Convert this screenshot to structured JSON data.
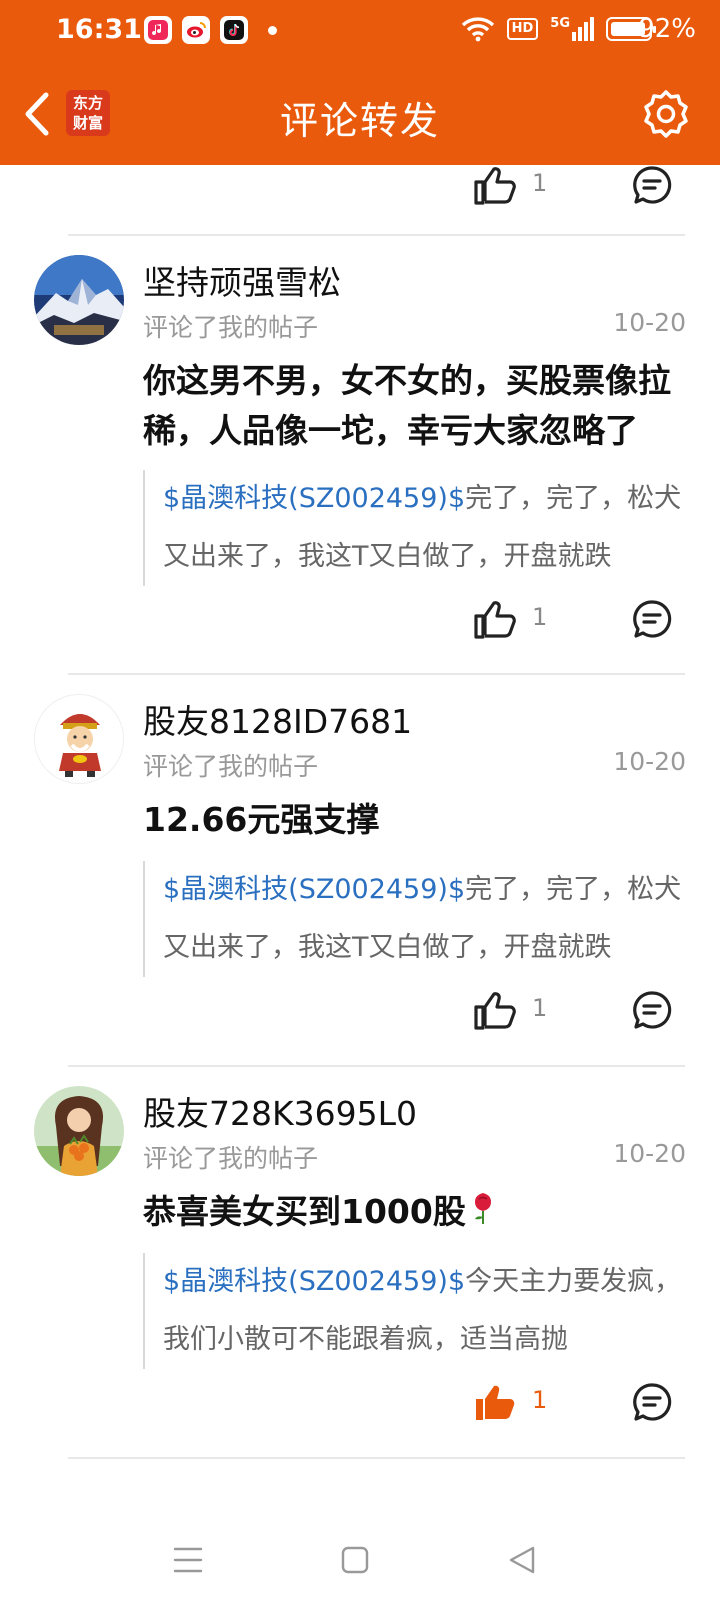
{
  "status": {
    "time": "16:31",
    "battery_pct": "92%",
    "hd": "HD",
    "network": "5G",
    "apps": [
      "music-app-icon",
      "weibo-app-icon",
      "tiktok-app-icon"
    ]
  },
  "header": {
    "logo_line1": "东方",
    "logo_line2": "财富",
    "title": "评论转发",
    "bg_color": "#ea5a0c"
  },
  "previous": {
    "like_count": "1"
  },
  "posts": [
    {
      "username": "坚持顽强雪松",
      "subtitle": "评论了我的帖子",
      "date": "10-20",
      "content": "你这男不男，女不女的，买股票像拉稀，人品像一坨，幸亏大家忽略了",
      "quote_stock": "$晶澳科技(SZ002459)$",
      "quote_text": "完了，完了，松犬又出来了，我这T又白做了，开盘就跌",
      "like_count": "1",
      "liked": false
    },
    {
      "username": "股友8128ID7681",
      "subtitle": "评论了我的帖子",
      "date": "10-20",
      "content": "12.66元强支撑",
      "quote_stock": "$晶澳科技(SZ002459)$",
      "quote_text": "完了，完了，松犬又出来了，我这T又白做了，开盘就跌",
      "like_count": "1",
      "liked": false
    },
    {
      "username": "股友728K3695L0",
      "subtitle": "评论了我的帖子",
      "date": "10-20",
      "content": "恭喜美女买到1000股",
      "content_emoji": "🌹",
      "quote_stock": "$晶澳科技(SZ002459)$",
      "quote_text": "今天主力要发疯，我们小散可不能跟着疯，适当高抛",
      "like_count": "1",
      "liked": true
    }
  ],
  "colors": {
    "accent": "#ea5a0c",
    "link": "#2a6fc0",
    "muted": "#999999"
  }
}
